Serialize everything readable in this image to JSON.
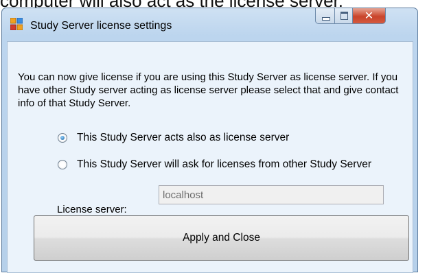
{
  "background_text": "computer will also act as the license server.",
  "window": {
    "title": "Study Server license settings",
    "icon": "app-window-icon",
    "caption_buttons": [
      "minimize-icon",
      "maximize-icon",
      "close-icon"
    ]
  },
  "content": {
    "description": "You can now give license if you are using this Study Server as license server. If you have other Study server acting as license server please select that and give contact info of that Study Server.",
    "options": [
      {
        "label": "This Study Server acts also as license server",
        "selected": true
      },
      {
        "label": "This Study Server will ask for licenses from other Study Server",
        "selected": false
      }
    ],
    "license_server_label": "License server:",
    "license_server_value": "localhost",
    "apply_button": "Apply and Close"
  },
  "colors": {
    "title_bar": "#bcd5ee",
    "client_bg": "#ebf3fb",
    "close_button": "#c9442b"
  }
}
